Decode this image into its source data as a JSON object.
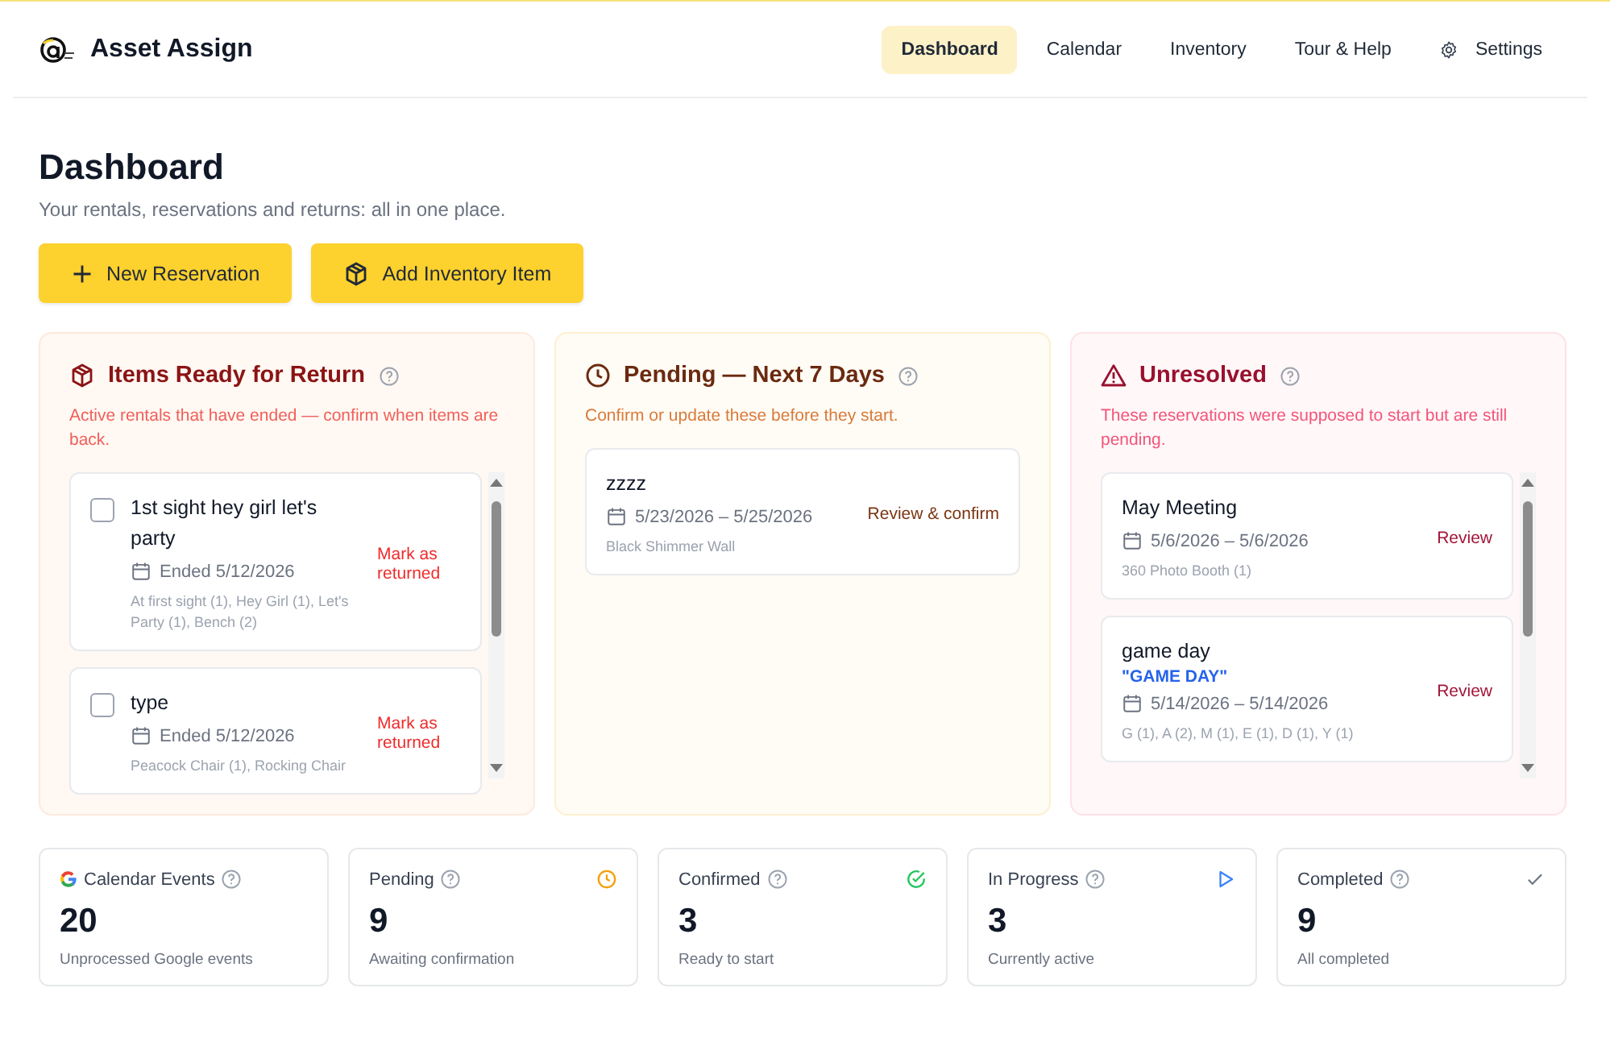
{
  "brand": {
    "name": "Asset Assign"
  },
  "nav": [
    {
      "label": "Dashboard",
      "selected": true,
      "kind": "plain"
    },
    {
      "label": "Calendar",
      "selected": false,
      "kind": "plain"
    },
    {
      "label": "Inventory",
      "selected": false,
      "kind": "plain"
    },
    {
      "label": "Tour & Help",
      "selected": false,
      "kind": "plain"
    },
    {
      "label": "Settings",
      "selected": false,
      "kind": "settings"
    }
  ],
  "page": {
    "title": "Dashboard",
    "subtitle": "Your rentals, reservations and returns: all in one place."
  },
  "actions": [
    {
      "label": "New Reservation",
      "kind": "add"
    },
    {
      "label": "Add Inventory Item",
      "kind": "box"
    }
  ],
  "panels": [
    {
      "kind": "returns",
      "title": "Items Ready for Return",
      "description": "Active rentals that have ended — confirm when items are back.",
      "scrollable": true,
      "cards": [
        {
          "title": "1st sight hey girl let's party",
          "date": "Ended 5/12/2026",
          "items": "At first sight (1), Hey Girl (1), Let's Party (1), Bench (2)",
          "action": "Mark as returned",
          "checked": false
        },
        {
          "title": "type",
          "date": "Ended 5/12/2026",
          "items": "Peacock Chair (1), Rocking Chair",
          "action": "Mark as returned",
          "checked": false
        }
      ]
    },
    {
      "kind": "pending",
      "title": "Pending — Next 7 Days",
      "description": "Confirm or update these before they start.",
      "scrollable": false,
      "cards": [
        {
          "title": "zzzz",
          "date": "5/23/2026 – 5/25/2026",
          "items": "Black Shimmer Wall",
          "action": "Review & confirm"
        }
      ]
    },
    {
      "kind": "unresolved",
      "title": "Unresolved",
      "description": "These reservations were supposed to start but are still pending.",
      "scrollable": true,
      "cards": [
        {
          "title": "May Meeting",
          "date": "5/6/2026 – 5/6/2026",
          "items": "360 Photo Booth (1)",
          "action": "Review"
        },
        {
          "title": "game day",
          "tag": "\"GAME DAY\"",
          "date": "5/14/2026 – 5/14/2026",
          "items": "G (1), A (2), M (1), E (1), D (1), Y (1)",
          "action": "Review"
        }
      ]
    }
  ],
  "stats": [
    {
      "kind": "google",
      "label": "Calendar Events",
      "value": "20",
      "note": "Unprocessed Google events"
    },
    {
      "kind": "pending",
      "label": "Pending",
      "value": "9",
      "note": "Awaiting confirmation"
    },
    {
      "kind": "confirmed",
      "label": "Confirmed",
      "value": "3",
      "note": "Ready to start"
    },
    {
      "kind": "progress",
      "label": "In Progress",
      "value": "3",
      "note": "Currently active"
    },
    {
      "kind": "completed",
      "label": "Completed",
      "value": "9",
      "note": "All completed"
    }
  ]
}
